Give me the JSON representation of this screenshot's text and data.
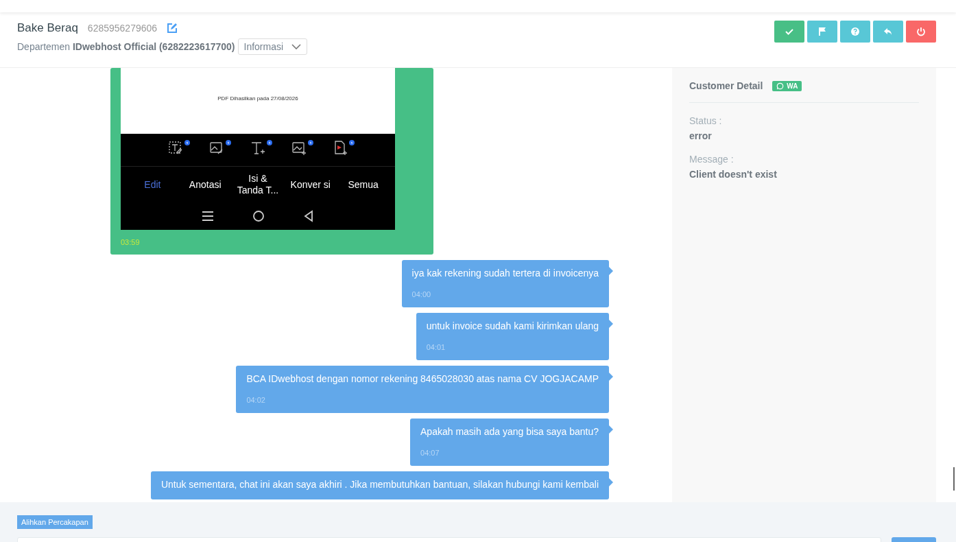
{
  "header": {
    "name": "Bake Beraq",
    "phone": "6285956279606",
    "department_label": "Departemen",
    "department_name": "IDwebhost Official (6282223617700)",
    "category": "Informasi"
  },
  "action_buttons": [
    {
      "kind": "check",
      "color": "#48bf86"
    },
    {
      "kind": "flag",
      "color": "#58c7d6"
    },
    {
      "kind": "help",
      "color": "#58c7d6"
    },
    {
      "kind": "reply",
      "color": "#58c7d6"
    },
    {
      "kind": "power",
      "color": "#f96868"
    }
  ],
  "customer_detail": {
    "title": "Customer Detail",
    "badge": "WA",
    "fields": [
      {
        "label": "Status :",
        "value": "error"
      },
      {
        "label": "Message :",
        "value": "Client doesn't exist"
      }
    ]
  },
  "messages": [
    {
      "kind": "image",
      "time": "03:59",
      "screenshot": {
        "caption": "PDF Dihasilkan pada 27/08/2026",
        "tabs": [
          {
            "label": "Edit",
            "selected": true
          },
          {
            "label": "Anotasi",
            "selected": false
          },
          {
            "label": "Isi & Tanda T...",
            "selected": false
          },
          {
            "label": "Konver si",
            "selected": false
          },
          {
            "label": "Semua",
            "selected": false
          }
        ]
      }
    },
    {
      "kind": "text",
      "text": "iya kak rekening sudah tertera di invoicenya",
      "time": "04:00"
    },
    {
      "kind": "text",
      "text": "untuk invoice sudah kami kirimkan ulang",
      "time": "04:01"
    },
    {
      "kind": "text",
      "text": "BCA IDwebhost dengan nomor rekening 8465028030 atas nama CV JOGJACAMP",
      "time": "04:02"
    },
    {
      "kind": "text",
      "text": "Apakah masih ada yang bisa saya bantu?",
      "time": "04:07"
    },
    {
      "kind": "text",
      "text": "Untuk sementara, chat ini akan saya akhiri . Jika membutuhkan bantuan, silakan hubungi kami kembali"
    }
  ],
  "footer": {
    "transfer_button": "Alihkan Percakapan"
  }
}
